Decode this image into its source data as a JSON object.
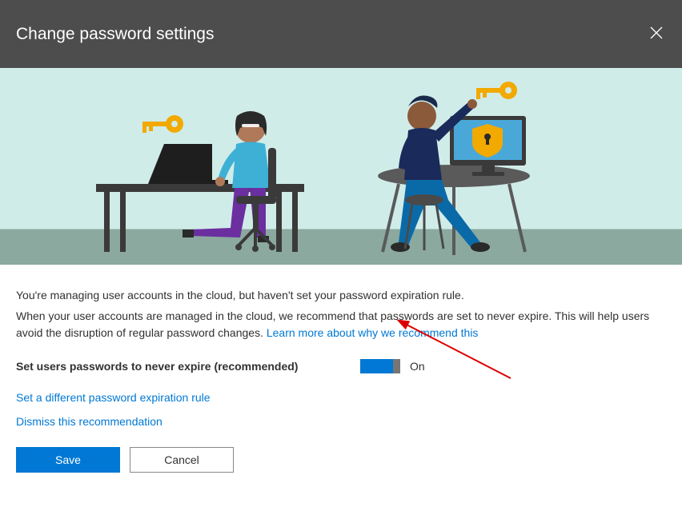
{
  "header": {
    "title": "Change password settings"
  },
  "content": {
    "intro": "You're managing user accounts in the cloud, but haven't set your password expiration rule.",
    "desc_part1": "When your user accounts are managed in the cloud, we recommend that passwords are set to never expire. This will help users avoid the disruption of regular password changes. ",
    "learn_more": "Learn more about why we recommend this",
    "setting_label": "Set users passwords to never expire (recommended)",
    "toggle_state": "On",
    "link_different_rule": "Set a different password expiration rule",
    "link_dismiss": "Dismiss this recommendation"
  },
  "buttons": {
    "save": "Save",
    "cancel": "Cancel"
  }
}
